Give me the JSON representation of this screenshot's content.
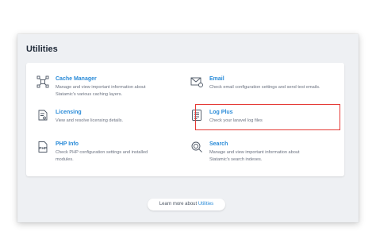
{
  "page_title": "Utilities",
  "tools": [
    {
      "icon": "cache-manager-icon",
      "title": "Cache Manager",
      "description": "Manage and view important information about Statamic's various caching layers."
    },
    {
      "icon": "email-icon",
      "title": "Email",
      "description": "Check email configuration settings and send test emails."
    },
    {
      "icon": "licensing-icon",
      "title": "Licensing",
      "description": "View and resolve licensing details."
    },
    {
      "icon": "log-plus-icon",
      "title": "Log Plus",
      "description": "Check your laravel log files"
    },
    {
      "icon": "php-info-icon",
      "title": "PHP Info",
      "description": "Check PHP configuration settings and installed modules."
    },
    {
      "icon": "search-icon",
      "title": "Search",
      "description": "Manage and view important information about Statamic's search indexes."
    }
  ],
  "learn_more": {
    "prefix": "Learn more about ",
    "link": "Utilities"
  },
  "colors": {
    "accent": "#2a8bd8",
    "highlight": "#e53935",
    "background": "#eef0f3"
  }
}
